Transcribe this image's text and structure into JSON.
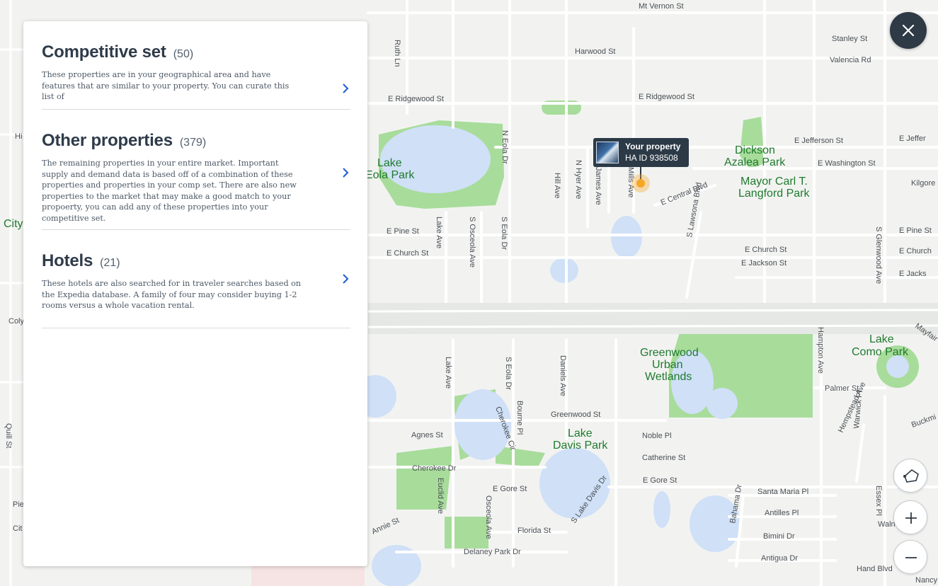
{
  "panel": {
    "sections": [
      {
        "title": "Competitive set",
        "count": "(50)",
        "description": "These properties are in your geographical area and have features that are similar to your property. You can curate this list of"
      },
      {
        "title": "Other properties",
        "count": "(379)",
        "description": "The remaining properties in your entire market. Important supply and demand data is based off of a combination of these properties and properties in your comp set. There are also new properties to the market that may make a good match to your propoerty, you can add any of these properties into your competitive set."
      },
      {
        "title": "Hotels",
        "count": "(21)",
        "description": "These hotels are also searched for in traveler searches based on the Expedia database. A family of four may consider buying 1-2 rooms versus a whole vacation rental."
      }
    ]
  },
  "property_marker": {
    "title": "Your property",
    "id_label": "HA ID 938508"
  },
  "icons": {
    "close": "close-icon",
    "draw": "draw-area-icon",
    "zoom_in": "plus-icon",
    "zoom_out": "minus-icon",
    "chevron": "chevron-right-icon"
  },
  "colors": {
    "panel_title": "#2f3b4a",
    "chevron": "#1d5bd6",
    "close_button": "#2e3a45",
    "marker": "#f6a623",
    "park": "#a8dc9b",
    "water": "#cfe0f7"
  },
  "map": {
    "streets": [
      "Mt Vernon St",
      "Harwood St",
      "Stanley St",
      "Valencia Rd",
      "E Ridgewood St",
      "E Ridgewood St",
      "E Jefferson St",
      "E Jeffer",
      "E Washington St",
      "Kilgore",
      "E Central Blvd",
      "E Pine St",
      "E Pine St",
      "E Church St",
      "E Church St",
      "E Jackson St",
      "E Church",
      "E Jacks",
      "Greenwood St",
      "Agnes St",
      "Noble Pl",
      "Catherine St",
      "Cherokee Dr",
      "E Gore St",
      "E Gore St",
      "Santa Maria Pl",
      "Antilles Pl",
      "Bimini Dr",
      "Antigua Dr",
      "Florida St",
      "Delaney Park Dr",
      "Annie St",
      "Palmer St",
      "Walnut St",
      "Hand Blvd",
      "Nancy",
      "Ruth Ln",
      "N Eola Dr",
      "Hill Ave",
      "N Hyer Ave",
      "James Ave",
      "Mills Ave",
      "Lake Ave",
      "S Osceola Ave",
      "S Eola Dr",
      "S Lawsona Blvd",
      "S Glenwood Ave",
      "Hampton Ave",
      "Lake Ave",
      "S Eola Dr",
      "Daniels Ave",
      "Bourne Pl",
      "Cherokee Cir",
      "Euclid Ave",
      "Osceola Ave",
      "S Lake Davis Dr",
      "Bahama Dr",
      "Hempstead Ave",
      "Warwick Pl",
      "Essex Pl",
      "Mayfair",
      "Buckmi",
      "Quill St",
      "Pie",
      "Cit",
      "Coly",
      "Hi"
    ],
    "places": [
      "Lake",
      "Eola Park",
      "Dickson",
      "Azalea Park",
      "Mayor Carl T.",
      "Langford Park",
      "City",
      "Greenwood",
      "Urban",
      "Wetlands",
      "Lake",
      "Como Park",
      "Lake",
      "Davis Park"
    ]
  }
}
